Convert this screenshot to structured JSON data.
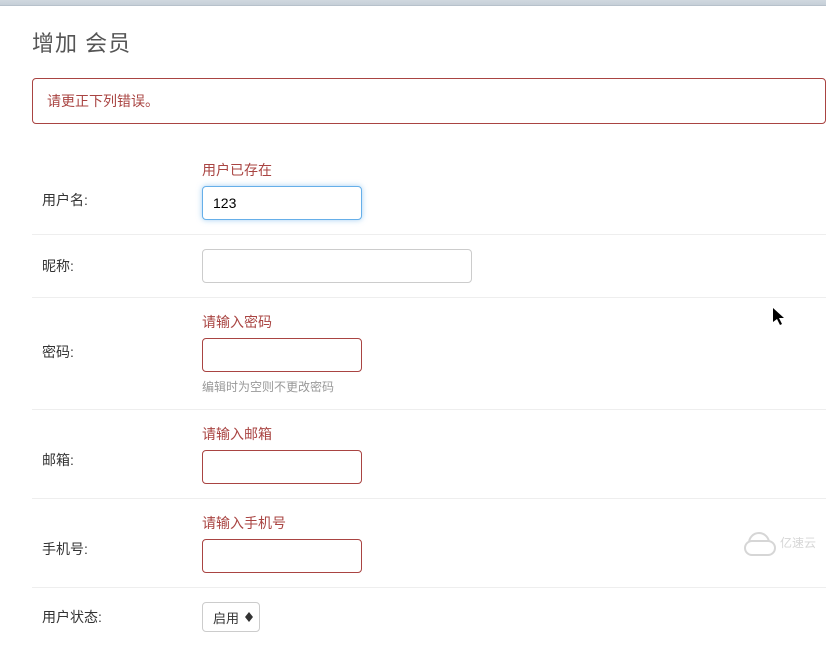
{
  "header": {
    "title": "增加 会员"
  },
  "alert": {
    "message": "请更正下列错误。"
  },
  "form": {
    "username": {
      "label": "用户名:",
      "error": "用户已存在",
      "value": "123"
    },
    "nickname": {
      "label": "昵称:",
      "value": ""
    },
    "password": {
      "label": "密码:",
      "error": "请输入密码",
      "value": "",
      "help": "编辑时为空则不更改密码"
    },
    "email": {
      "label": "邮箱:",
      "error": "请输入邮箱",
      "value": ""
    },
    "phone": {
      "label": "手机号:",
      "error": "请输入手机号",
      "value": ""
    },
    "status": {
      "label": "用户状态:",
      "selected": "启用"
    }
  },
  "watermark": {
    "text": "亿速云"
  }
}
